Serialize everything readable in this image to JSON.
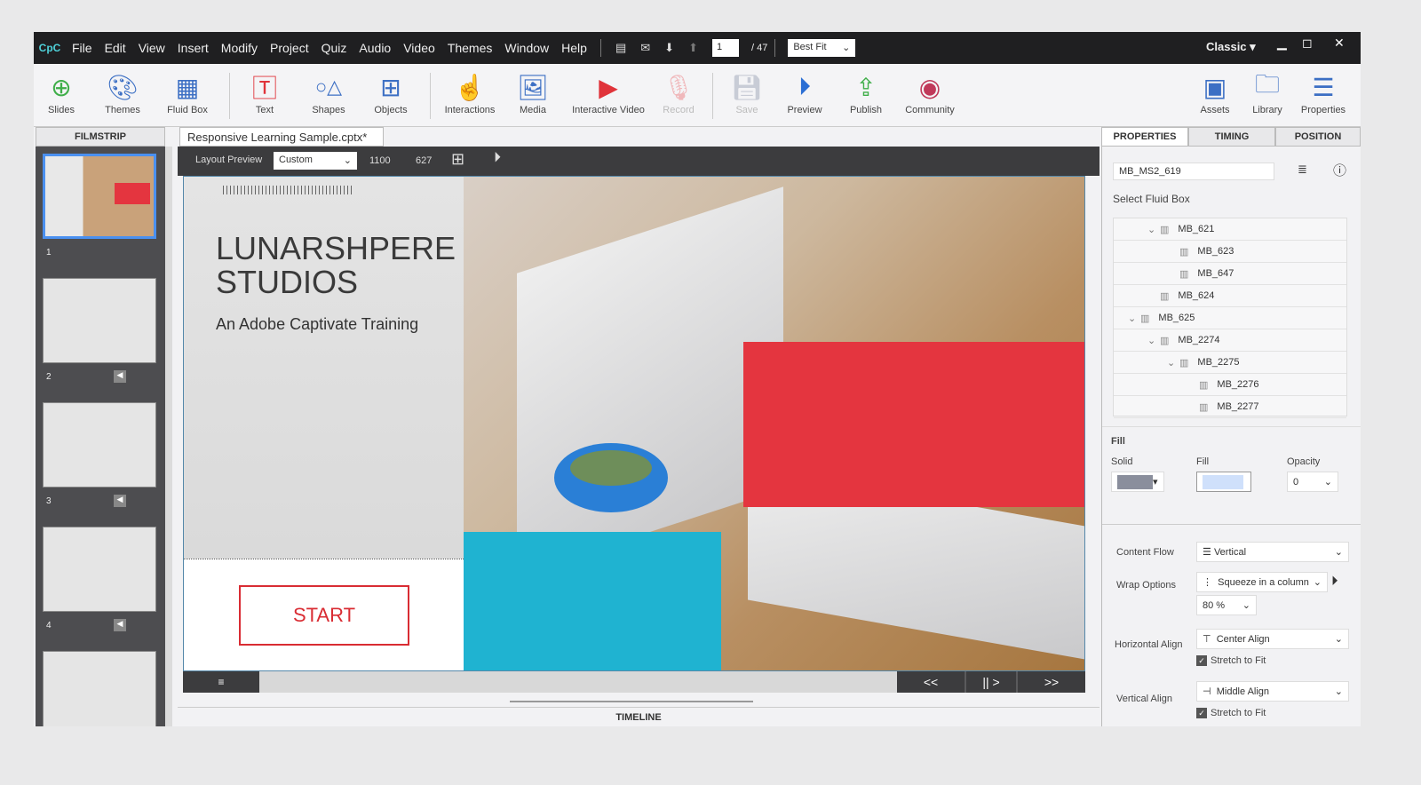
{
  "menubar": {
    "logo": "CpC",
    "items": [
      "File",
      "Edit",
      "View",
      "Insert",
      "Modify",
      "Project",
      "Quiz",
      "Audio",
      "Video",
      "Themes",
      "Window",
      "Help"
    ],
    "page_current": "1",
    "page_total": "/ 47",
    "zoom": "Best Fit",
    "workspace": "Classic"
  },
  "toolbar": {
    "items": [
      {
        "label": "Slides",
        "icon": "plus-circle"
      },
      {
        "label": "Themes",
        "icon": "palette"
      },
      {
        "label": "Fluid Box",
        "icon": "fluid-box"
      },
      {
        "label": "Text",
        "icon": "text-t"
      },
      {
        "label": "Shapes",
        "icon": "shapes"
      },
      {
        "label": "Objects",
        "icon": "grid"
      },
      {
        "label": "Interactions",
        "icon": "hand-pointer"
      },
      {
        "label": "Media",
        "icon": "image"
      },
      {
        "label": "Interactive Video",
        "icon": "video-play"
      },
      {
        "label": "Record",
        "icon": "microphone"
      },
      {
        "label": "Save",
        "icon": "floppy"
      },
      {
        "label": "Preview",
        "icon": "play-circle"
      },
      {
        "label": "Publish",
        "icon": "publish"
      },
      {
        "label": "Community",
        "icon": "community"
      },
      {
        "label": "Assets",
        "icon": "assets"
      },
      {
        "label": "Library",
        "icon": "library"
      },
      {
        "label": "Properties",
        "icon": "hamburger"
      }
    ]
  },
  "filmstrip": {
    "title": "FILMSTRIP",
    "slides": [
      "1",
      "2",
      "3",
      "4"
    ]
  },
  "document": {
    "tab": "Responsive Learning Sample.cptx*",
    "layout_preview": "Layout Preview",
    "preset": "Custom",
    "width": "1100",
    "height": "627"
  },
  "slide": {
    "title_line1": "LUNARSHPERE",
    "title_line2": "STUDIOS",
    "subtitle": "An Adobe Captivate Training",
    "start": "START",
    "colors": {
      "red": "#e4353f",
      "cyan": "#1fb3d1"
    }
  },
  "playback": {
    "rewind": "<<",
    "pause": "||",
    "next": ">",
    "forward": ">>"
  },
  "timeline": "TIMELINE",
  "panel": {
    "tabs": [
      "PROPERTIES",
      "TIMING",
      "POSITION"
    ],
    "name": "MB_MS2_619",
    "select_label": "Select Fluid Box",
    "tree": [
      {
        "label": "MB_621",
        "level": 2,
        "expand": true
      },
      {
        "label": "MB_623",
        "level": 3,
        "expand": false
      },
      {
        "label": "MB_647",
        "level": 3,
        "expand": false
      },
      {
        "label": "MB_624",
        "level": 2,
        "expand": false
      },
      {
        "label": "MB_625",
        "level": 1,
        "expand": true
      },
      {
        "label": "MB_2274",
        "level": 2,
        "expand": true
      },
      {
        "label": "MB_2275",
        "level": 3,
        "expand": true
      },
      {
        "label": "MB_2276",
        "level": 4,
        "expand": false
      },
      {
        "label": "MB_2277",
        "level": 4,
        "expand": false
      }
    ],
    "fill_section": "Fill",
    "solid_label": "Solid",
    "fill_label": "Fill",
    "opacity_label": "Opacity",
    "opacity": "0",
    "solid_color": "#8a8e9c",
    "fill_color": "#cfe0fb",
    "content_flow_label": "Content Flow",
    "content_flow": "Vertical",
    "wrap_label": "Wrap Options",
    "wrap": "Squeeze in a column",
    "wrap_pct": "80 %",
    "halign_label": "Horizontal Align",
    "halign": "Center Align",
    "stretch1": "Stretch to Fit",
    "valign_label": "Vertical Align",
    "valign": "Middle Align",
    "stretch2": "Stretch to Fit"
  }
}
